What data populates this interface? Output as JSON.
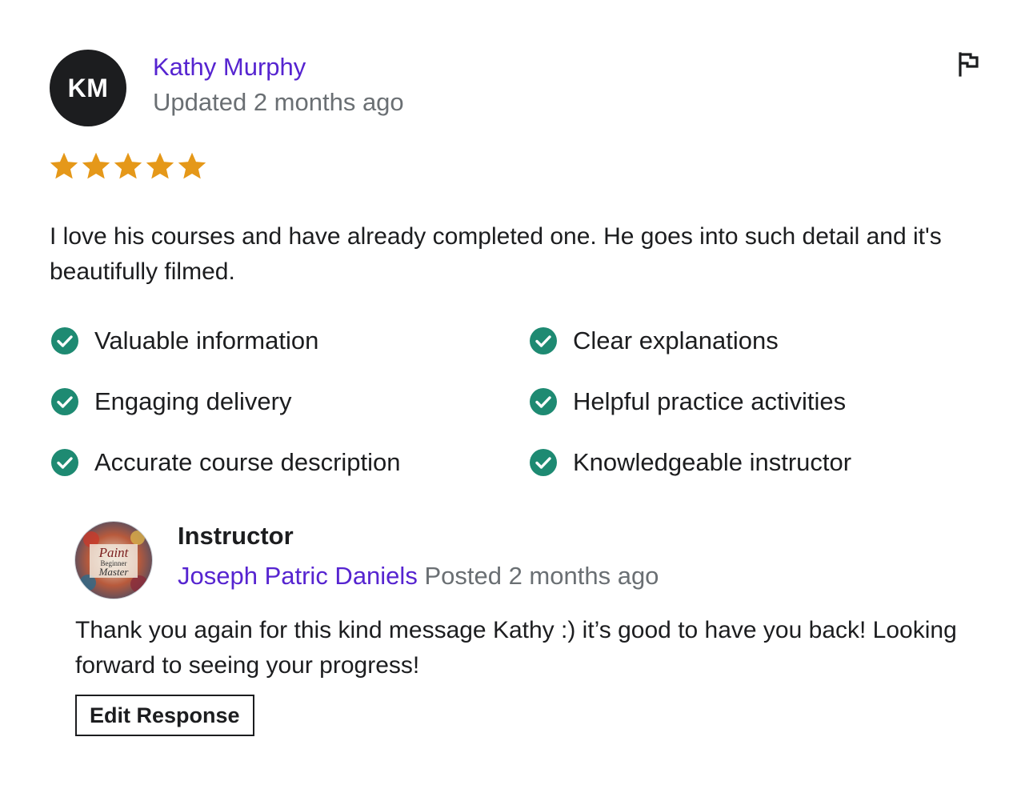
{
  "reviewer": {
    "initials": "KM",
    "name": "Kathy Murphy",
    "updated": "Updated 2 months ago",
    "rating": 5,
    "rating_max": 5,
    "star_color": "#e59819"
  },
  "review": {
    "text": "I love his courses and have already completed one. He goes into such detail and it's beautifully filmed."
  },
  "tags": [
    {
      "label": "Valuable information"
    },
    {
      "label": "Clear explanations"
    },
    {
      "label": "Engaging delivery"
    },
    {
      "label": "Helpful practice activities"
    },
    {
      "label": "Accurate course description"
    },
    {
      "label": "Knowledgeable instructor"
    }
  ],
  "instructor_response": {
    "role": "Instructor",
    "name": "Joseph Patric Daniels",
    "posted": "Posted 2 months ago",
    "avatar_text": [
      "Paint",
      "Beginner",
      "Master"
    ],
    "text": "Thank you again for this kind message Kathy :) it’s good to have you back! Looking forward to seeing your progress!",
    "edit_label": "Edit Response"
  },
  "colors": {
    "link": "#5624d0",
    "muted": "#6a6f73",
    "check": "#1e8a72",
    "text": "#1c1d1f"
  }
}
